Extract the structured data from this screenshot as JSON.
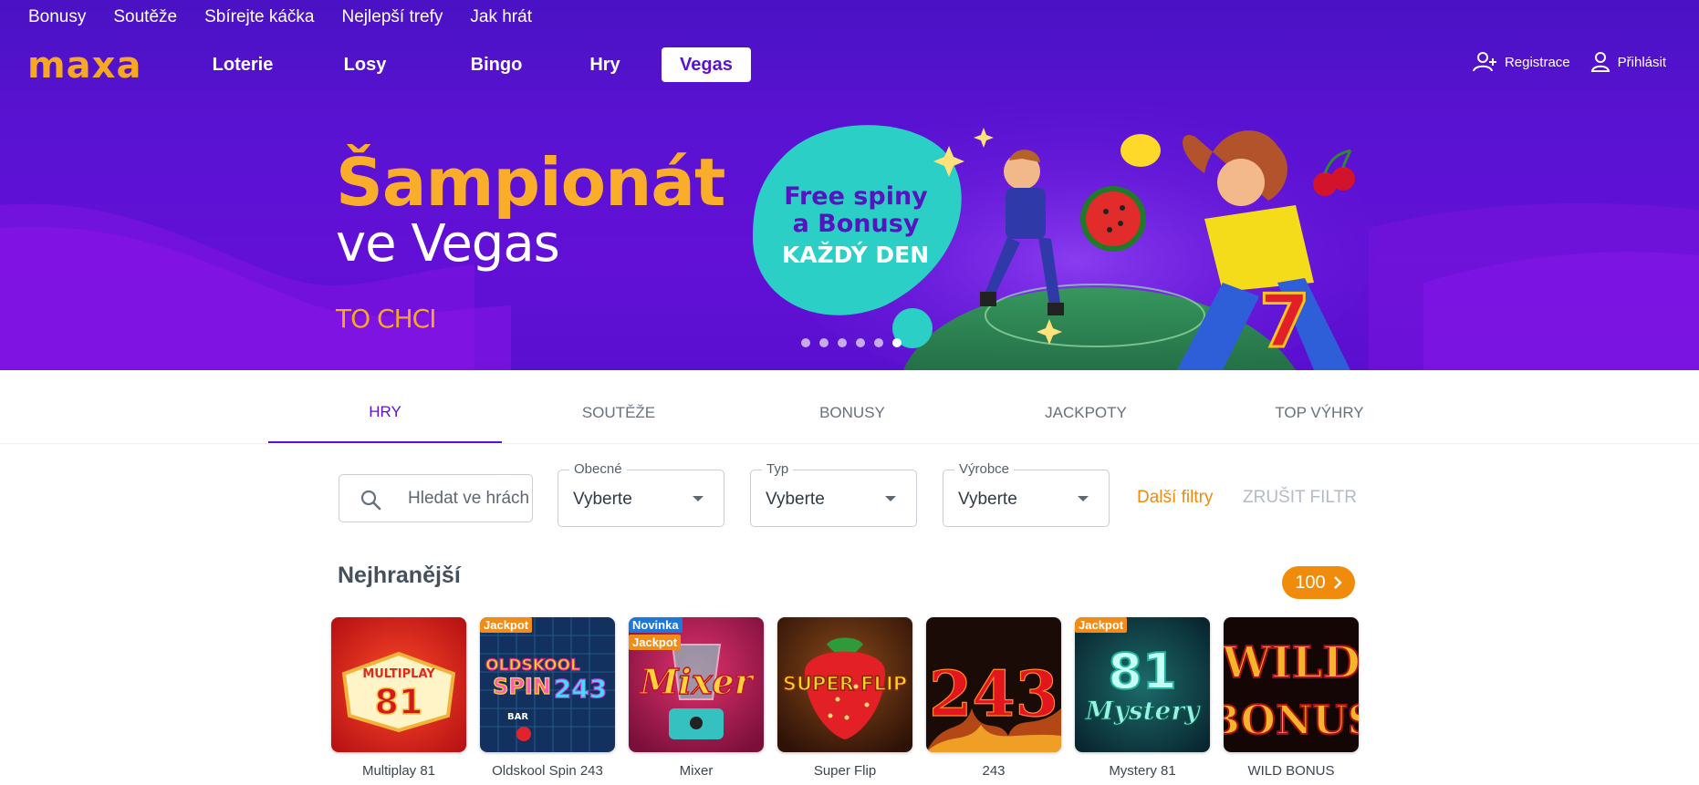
{
  "top_links": [
    "Bonusy",
    "Soutěže",
    "Sbírejte káčka",
    "Nejlepší trefy",
    "Jak hrát"
  ],
  "logo": "maxa",
  "main_nav": [
    {
      "label": "Loterie",
      "active": false
    },
    {
      "label": "Losy",
      "active": false
    },
    {
      "label": "Bingo",
      "active": false
    },
    {
      "label": "Hry",
      "active": false
    },
    {
      "label": "Vegas",
      "active": true
    }
  ],
  "account": {
    "register": "Registrace",
    "login": "Přihlásit"
  },
  "hero": {
    "title": "Šampionát",
    "subtitle": "ve Vegas",
    "cta": "TO CHCI",
    "promo_line1": "Free spiny",
    "promo_line2": "a Bonusy",
    "promo_line3": "KAŽDÝ DEN",
    "slides_total": 6,
    "slide_active": 6
  },
  "tabs": [
    {
      "label": "HRY",
      "active": true
    },
    {
      "label": "SOUTĚŽE",
      "active": false
    },
    {
      "label": "BONUSY",
      "active": false
    },
    {
      "label": "JACKPOTY",
      "active": false
    },
    {
      "label": "TOP VÝHRY",
      "active": false
    }
  ],
  "filters": {
    "search_placeholder": "Hledat ve hrách",
    "general": {
      "legend": "Obecné",
      "value": "Vyberte"
    },
    "type": {
      "legend": "Typ",
      "value": "Vyberte"
    },
    "maker": {
      "legend": "Výrobce",
      "value": "Vyberte"
    },
    "more": "Další filtry",
    "reset": "ZRUŠIT FILTR"
  },
  "colors": {
    "brand_purple": "#5b12cf",
    "accent_orange": "#f7a823",
    "pill_orange": "#f18b0b",
    "novinka_blue": "#1f78d8"
  },
  "section": {
    "title": "Nejhranější",
    "count": "100"
  },
  "games": [
    {
      "name": "Multiplay 81",
      "badges": []
    },
    {
      "name": "Oldskool Spin 243",
      "badges": [
        "Jackpot"
      ]
    },
    {
      "name": "Mixer",
      "badges": [
        "Novinka",
        "Jackpot"
      ]
    },
    {
      "name": "Super Flip",
      "badges": []
    },
    {
      "name": "243",
      "badges": []
    },
    {
      "name": "Mystery 81",
      "badges": [
        "Jackpot"
      ]
    },
    {
      "name": "WILD BONUS",
      "badges": []
    }
  ],
  "thumb_text": {
    "multiplay_top": "MULTIPLAY",
    "multiplay_num": "81",
    "oldskool_a": "OLDSKOOL",
    "oldskool_b": "SPIN",
    "oldskool_num": "243",
    "oldskool_bar": "BAR",
    "mixer": "Mixer",
    "superflip": "SUPER FLIP",
    "n243": "243",
    "mystery_num": "81",
    "mystery": "Mystery",
    "wild": "WILD",
    "bonus": "BONUS"
  }
}
